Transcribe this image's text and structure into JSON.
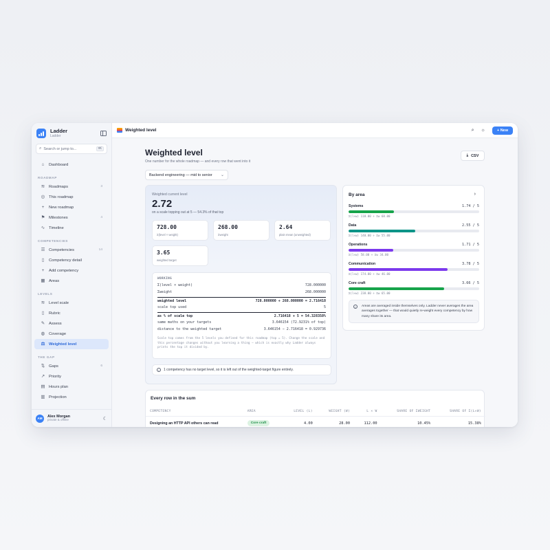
{
  "app": {
    "name": "Ladder",
    "sub": "Ladder"
  },
  "search": {
    "placeholder": "Search or jump to...",
    "shortcut": "⌘K"
  },
  "sidebar": {
    "dashboard": "Dashboard",
    "sections": [
      {
        "title": "ROADMAP",
        "items": [
          {
            "label": "Roadmaps",
            "count": "3",
            "icon": "layers-icon"
          },
          {
            "label": "This roadmap",
            "count": "",
            "icon": "compass-icon"
          },
          {
            "label": "New roadmap",
            "count": "",
            "icon": "plus-icon"
          },
          {
            "label": "Milestones",
            "count": "4",
            "icon": "flag-icon"
          },
          {
            "label": "Timeline",
            "count": "",
            "icon": "pulse-icon"
          }
        ]
      },
      {
        "title": "COMPETENCIES",
        "items": [
          {
            "label": "Competencies",
            "count": "14",
            "icon": "list-icon"
          },
          {
            "label": "Competency detail",
            "count": "",
            "icon": "file-icon"
          },
          {
            "label": "Add competency",
            "count": "",
            "icon": "plus-icon"
          },
          {
            "label": "Areas",
            "count": "",
            "icon": "grid-icon"
          }
        ]
      },
      {
        "title": "LEVELS",
        "items": [
          {
            "label": "Level scale",
            "count": "",
            "icon": "layers-icon"
          },
          {
            "label": "Rubric",
            "count": "",
            "icon": "file-icon"
          },
          {
            "label": "Assess",
            "count": "",
            "icon": "pencil-icon"
          },
          {
            "label": "Coverage",
            "count": "",
            "icon": "globe-icon"
          },
          {
            "label": "Weighted level",
            "count": "",
            "icon": "scale-icon"
          }
        ]
      },
      {
        "title": "THE GAP",
        "items": [
          {
            "label": "Gaps",
            "count": "6",
            "icon": "arrows-icon"
          },
          {
            "label": "Priority",
            "count": "",
            "icon": "trend-icon"
          },
          {
            "label": "Hours plan",
            "count": "",
            "icon": "doc-icon"
          },
          {
            "label": "Projection",
            "count": "",
            "icon": "chart-icon"
          }
        ]
      }
    ]
  },
  "user": {
    "initials": "AM",
    "name": "Alex Morgan",
    "sub": "private & offline"
  },
  "topbar": {
    "title": "Weighted level",
    "new_label": "New"
  },
  "page": {
    "title": "Weighted level",
    "subtitle": "One number for the whole roadmap — and every row that went into it",
    "csv_label": "CSV",
    "roadmap_select": "Backend engineering — mid to senior"
  },
  "weighted": {
    "label": "Weighted current level",
    "value": "2.72",
    "sub": "on a scale topping out at 5 — 54.3% of that top",
    "stats": [
      {
        "value": "728.00",
        "label": "Σ(level × weight)"
      },
      {
        "value": "268.00",
        "label": "Σweight"
      },
      {
        "value": "2.64",
        "label": "plain mean (unweighted)"
      },
      {
        "value": "3.65",
        "label": "weighted target"
      }
    ]
  },
  "working": {
    "title": "WORKING",
    "rows": [
      {
        "k": "Σ(level × weight)",
        "v": "728.000000"
      },
      {
        "k": "Σweight",
        "v": "268.000000"
      },
      {
        "k": "weighted level",
        "v": "728.000000 ÷ 268.000000 = 2.716418"
      },
      {
        "k": "scale top used",
        "v": "5"
      },
      {
        "k": "as % of scale top",
        "v": "2.716418 ÷ 5 = 54.328358%"
      },
      {
        "k": "same maths on your targets",
        "v": "3.646154 (72.9231% of top)"
      },
      {
        "k": "distance to the weighted target",
        "v": "3.646154 − 2.716418 = 0.929736"
      }
    ],
    "note": "Scale top comes from the 5 levels you defined for this roadmap (top = 5). Change the scale and this percentage changes without you learning a thing — which is exactly why Ladder always prints the top it divided by."
  },
  "info_note": "1 competency has no target level, so it is left out of the weighted-target figure entirely.",
  "by_area": {
    "title": "By area",
    "areas": [
      {
        "name": "Systems",
        "score": "1.74 / 5",
        "fraction": 0.348,
        "color": "#16a34a",
        "formula": "Σ(l×w) 118.00 ÷ Σw 68.00"
      },
      {
        "name": "Data",
        "score": "2.55 / 5",
        "fraction": 0.51,
        "color": "#0d9488",
        "formula": "Σ(l×w) 140.00 ÷ Σw 55.00"
      },
      {
        "name": "Operations",
        "score": "1.71 / 5",
        "fraction": 0.342,
        "color": "#7c3aed",
        "formula": "Σ(l×w) 58.00 ÷ Σw 34.00"
      },
      {
        "name": "Communication",
        "score": "3.78 / 5",
        "fraction": 0.756,
        "color": "#7c3aed",
        "formula": "Σ(l×w) 174.00 ÷ Σw 46.00"
      },
      {
        "name": "Core craft",
        "score": "3.66 / 5",
        "fraction": 0.732,
        "color": "#16a34a",
        "formula": "Σ(l×w) 238.00 ÷ Σw 65.00"
      }
    ],
    "note": "Areas are averaged inside themselves only. Ladder never averages the area averages together — that would quietly re-weight every competency by how many share its area."
  },
  "rows_table": {
    "title": "Every row in the sum",
    "headers": [
      "COMPETENCY",
      "AREA",
      "LEVEL (L)",
      "WEIGHT (W)",
      "L × W",
      "SHARE OF ΣWEIGHT",
      "SHARE OF Σ(L×W)"
    ],
    "rows": [
      {
        "competency": "Designing an HTTP API others can read",
        "area": "Core craft",
        "level": "4.00",
        "weight": "28.00",
        "lw": "112.00",
        "share_w": "10.45%",
        "share_lw": "15.38%"
      }
    ]
  }
}
